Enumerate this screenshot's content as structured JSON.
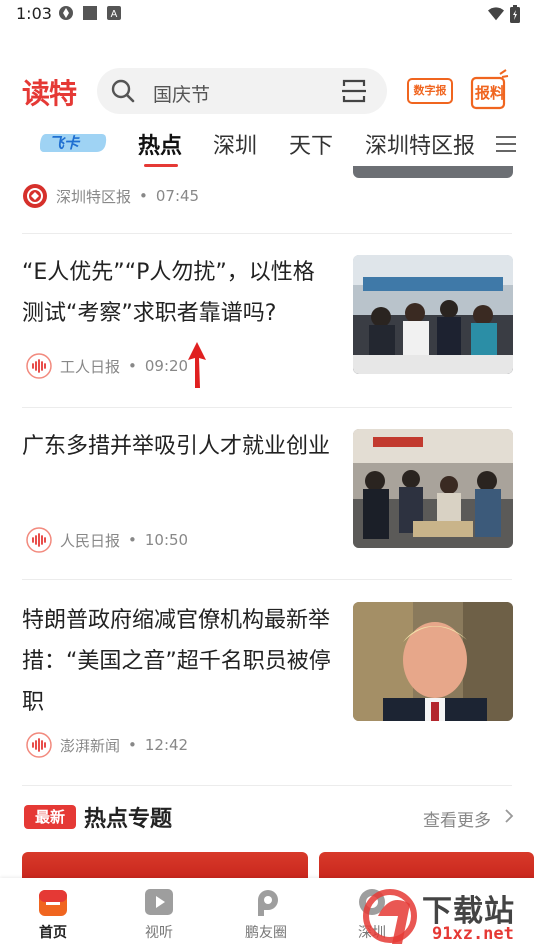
{
  "status_bar": {
    "time": "1:03",
    "icons": [
      "sync-icon",
      "square-icon",
      "text-a-icon",
      "wifi-icon",
      "battery-icon"
    ]
  },
  "header": {
    "logo": "读特",
    "search_placeholder": "国庆节",
    "digital_paper_label": "数字报",
    "report_label": "报料"
  },
  "tabs": {
    "feika": "飞卡",
    "items": [
      "热点",
      "深圳",
      "天下",
      "深圳特区报"
    ],
    "active": "热点"
  },
  "top_item": {
    "source": "深圳特区报",
    "time": "07:45"
  },
  "news": [
    {
      "title": "“E人优先”“P人勿扰”，以性格测试“考察”求职者靠谱吗?",
      "source": "工人日报",
      "time": "09:20",
      "thumb": "job-fair-crowd"
    },
    {
      "title": "广东多措并举吸引人才就业创业",
      "source": "人民日报",
      "time": "10:50",
      "thumb": "recruitment-hall"
    },
    {
      "title": "特朗普政府缩减官僚机构最新举措：“美国之音”超千名职员被停职",
      "source": "澎湃新闻",
      "time": "12:42",
      "thumb": "portrait-man"
    }
  ],
  "meta_separator": "•",
  "topics": {
    "badge": "最新",
    "title": "热点专题",
    "see_more": "查看更多"
  },
  "bottom_nav": [
    {
      "label": "首页",
      "icon": "home-icon",
      "active": true
    },
    {
      "label": "视听",
      "icon": "play-icon",
      "active": false
    },
    {
      "label": "鹏友圈",
      "icon": "circle-p-icon",
      "active": false
    },
    {
      "label": "深圳",
      "icon": "shenzhen-icon",
      "active": false
    }
  ],
  "watermark": {
    "text": "下载站",
    "url": "91xz.net"
  },
  "colors": {
    "brand_red": "#e53935",
    "orange": "#f0651f",
    "meta_gray": "#888888"
  }
}
